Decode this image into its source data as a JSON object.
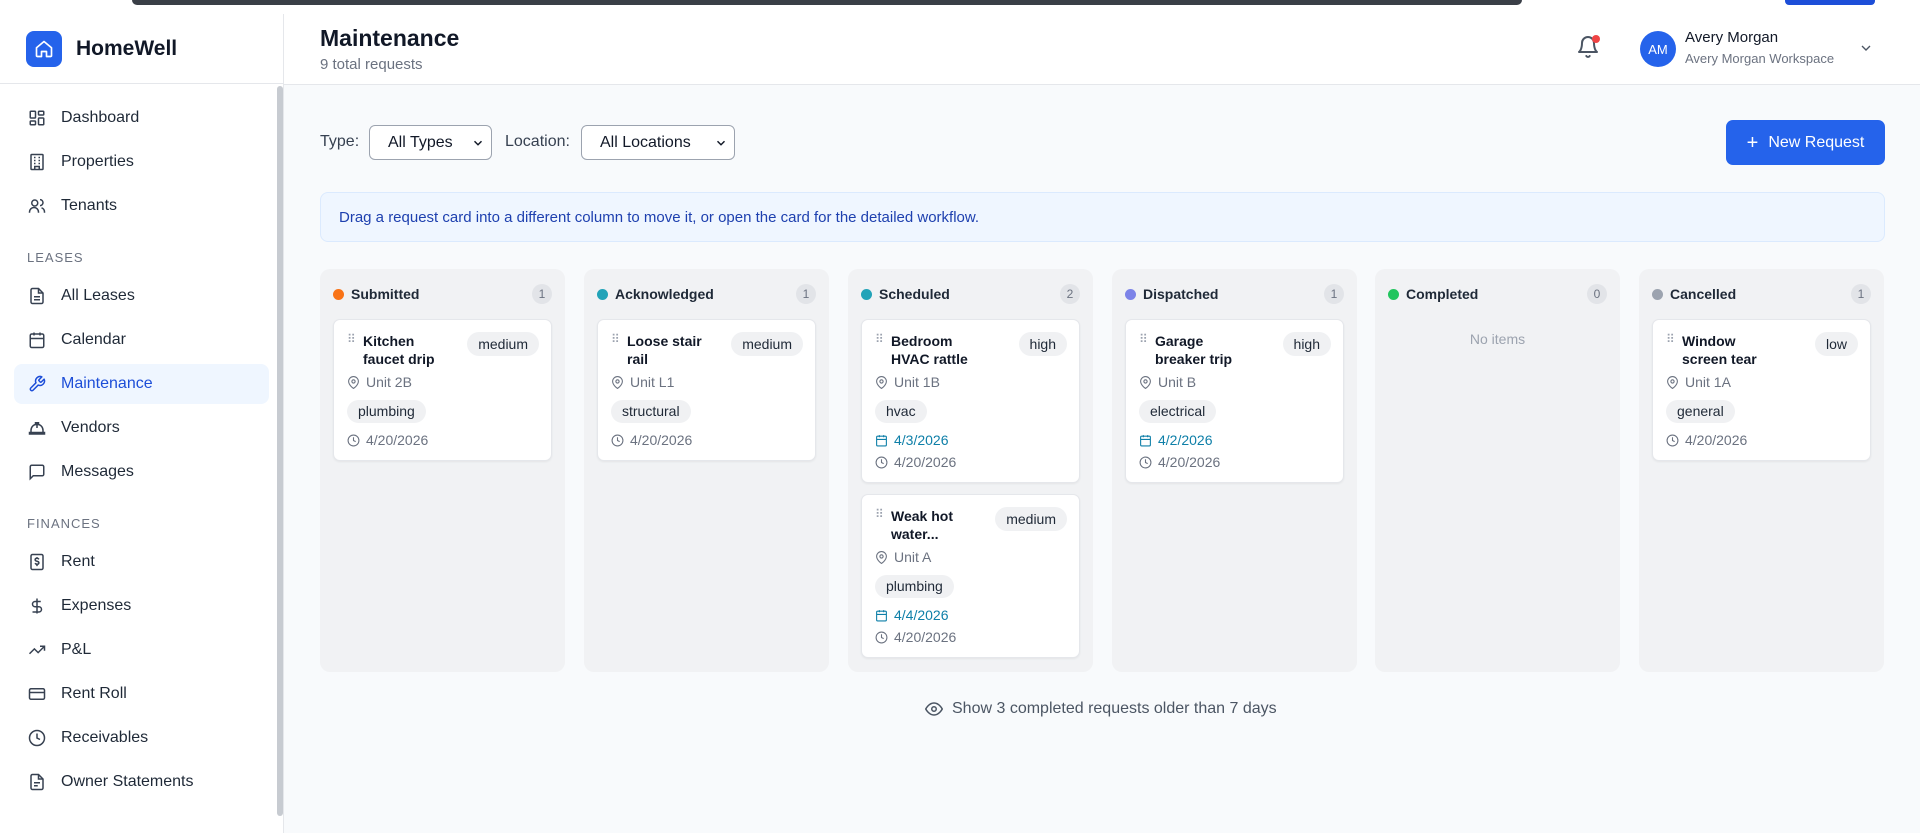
{
  "app": {
    "name": "HomeWell"
  },
  "sidebar": {
    "main": [
      {
        "label": "Dashboard",
        "icon": "dashboard-icon"
      },
      {
        "label": "Properties",
        "icon": "building-icon"
      },
      {
        "label": "Tenants",
        "icon": "users-icon"
      }
    ],
    "leases_section": "LEASES",
    "leases": [
      {
        "label": "All Leases",
        "icon": "document-icon"
      },
      {
        "label": "Calendar",
        "icon": "calendar-icon"
      },
      {
        "label": "Maintenance",
        "icon": "wrench-icon",
        "active": true
      },
      {
        "label": "Vendors",
        "icon": "hardhat-icon"
      },
      {
        "label": "Messages",
        "icon": "message-icon"
      }
    ],
    "finances_section": "FINANCES",
    "finances": [
      {
        "label": "Rent",
        "icon": "dollar-receipt-icon"
      },
      {
        "label": "Expenses",
        "icon": "dollar-icon"
      },
      {
        "label": "P&L",
        "icon": "trending-up-icon"
      },
      {
        "label": "Rent Roll",
        "icon": "credit-card-icon"
      },
      {
        "label": "Receivables",
        "icon": "clock-icon"
      },
      {
        "label": "Owner Statements",
        "icon": "document-lines-icon"
      }
    ]
  },
  "header": {
    "title": "Maintenance",
    "subtitle": "9 total requests",
    "user": {
      "initials": "AM",
      "name": "Avery Morgan",
      "workspace": "Avery Morgan Workspace"
    }
  },
  "toolbar": {
    "type_label": "Type:",
    "type_value": "All Types",
    "location_label": "Location:",
    "location_value": "All Locations",
    "new_label": "New Request"
  },
  "info": "Drag a request card into a different column to move it, or open the card for the detailed workflow.",
  "columns": [
    {
      "name": "Submitted",
      "count": "1",
      "color": "#f97316",
      "cards": [
        {
          "title": "Kitchen faucet drip",
          "priority": "medium",
          "unit": "Unit 2B",
          "tag": "plumbing",
          "created": "4/20/2026"
        }
      ]
    },
    {
      "name": "Acknowledged",
      "count": "1",
      "color": "#22a3b8",
      "cards": [
        {
          "title": "Loose stair rail",
          "priority": "medium",
          "unit": "Unit L1",
          "tag": "structural",
          "created": "4/20/2026"
        }
      ]
    },
    {
      "name": "Scheduled",
      "count": "2",
      "color": "#22a3b8",
      "cards": [
        {
          "title": "Bedroom HVAC rattle",
          "priority": "high",
          "unit": "Unit 1B",
          "tag": "hvac",
          "scheduled": "4/3/2026",
          "created": "4/20/2026"
        },
        {
          "title": "Weak hot water...",
          "priority": "medium",
          "unit": "Unit A",
          "tag": "plumbing",
          "scheduled": "4/4/2026",
          "created": "4/20/2026"
        }
      ]
    },
    {
      "name": "Dispatched",
      "count": "1",
      "color": "#7c83e8",
      "cards": [
        {
          "title": "Garage breaker trip",
          "priority": "high",
          "unit": "Unit B",
          "tag": "electrical",
          "scheduled": "4/2/2026",
          "created": "4/20/2026"
        }
      ]
    },
    {
      "name": "Completed",
      "count": "0",
      "color": "#22c55e",
      "empty_text": "No items",
      "cards": []
    },
    {
      "name": "Cancelled",
      "count": "1",
      "color": "#9ca3af",
      "cards": [
        {
          "title": "Window screen tear",
          "priority": "low",
          "unit": "Unit 1A",
          "tag": "general",
          "created": "4/20/2026"
        }
      ]
    }
  ],
  "footer": {
    "show_completed": "Show 3 completed requests older than 7 days"
  }
}
